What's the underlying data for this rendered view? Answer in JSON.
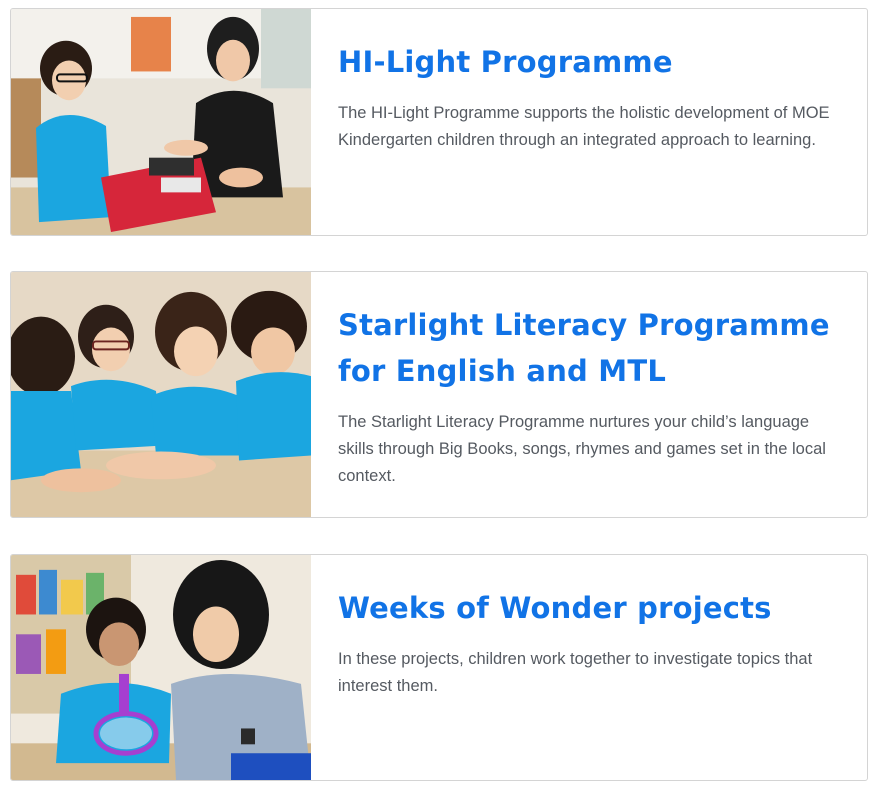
{
  "programmes": [
    {
      "title": "HI-Light Programme",
      "description": "The HI-Light Programme supports the holistic development of MOE Kindergarten children through an integrated approach to learning.",
      "photo_icon": "children-playing-shop-photo"
    },
    {
      "title": "Starlight Literacy Programme for English and MTL",
      "description": "The Starlight Literacy Programme nurtures your child’s language skills through Big Books, songs, rhymes and games set in the local context.",
      "photo_icon": "children-playing-game-photo"
    },
    {
      "title": "Weeks of Wonder projects",
      "description": "In these projects, children work together to investigate topics that interest them.",
      "photo_icon": "child-with-magnifier-photo"
    }
  ],
  "colors": {
    "title": "#1173e6",
    "text": "#555a61",
    "border": "#d4d4d4",
    "uniform": "#1ba6e0"
  }
}
